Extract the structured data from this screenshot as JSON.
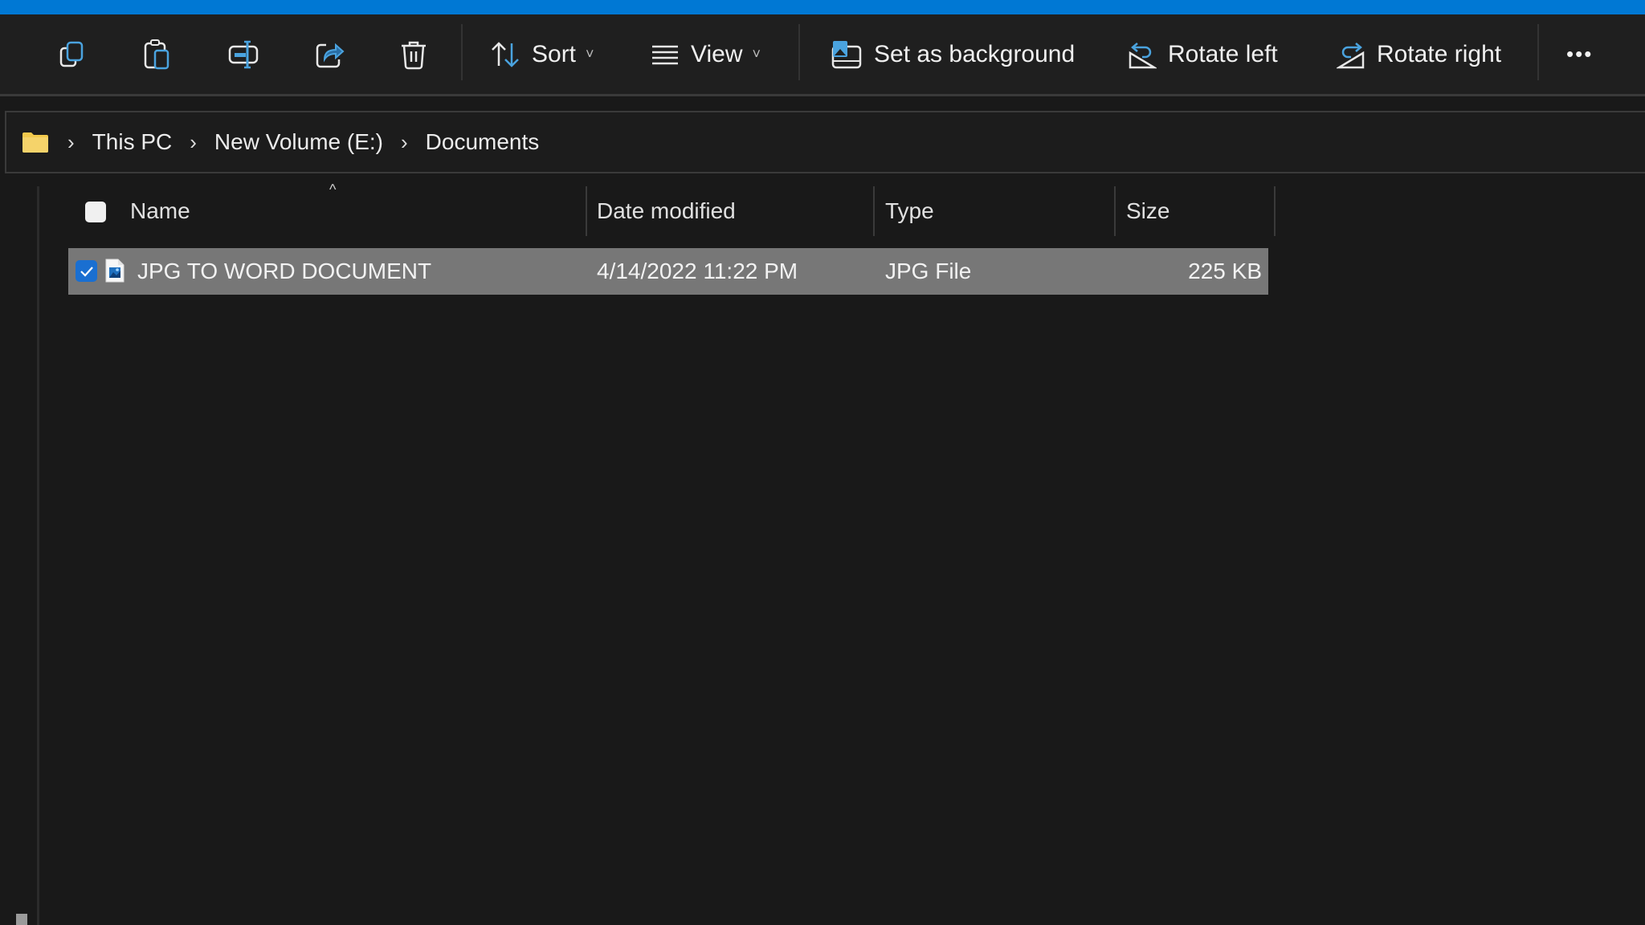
{
  "toolbar": {
    "copy_label": "Copy",
    "paste_label": "Paste",
    "rename_label": "Rename",
    "share_label": "Share",
    "delete_label": "Delete",
    "sort_label": "Sort",
    "view_label": "View",
    "set_background_label": "Set as background",
    "rotate_left_label": "Rotate left",
    "rotate_right_label": "Rotate right",
    "more_label": "•••"
  },
  "address_bar": {
    "icon": "folder-icon",
    "separator": "›",
    "breadcrumbs": [
      "This PC",
      "New Volume (E:)",
      "Documents"
    ]
  },
  "file_list": {
    "sort_indicator": "^",
    "columns": [
      "Name",
      "Date modified",
      "Type",
      "Size"
    ],
    "rows": [
      {
        "name": "JPG TO WORD DOCUMENT",
        "date_modified": "4/14/2022 11:22 PM",
        "type": "JPG File",
        "size": "225 KB",
        "selected": true
      }
    ]
  },
  "colors": {
    "accent": "#0078d4",
    "selection_row": "#777777",
    "checkbox_checked": "#1a6fd1",
    "background": "#191919",
    "folder": "#f2c94c"
  }
}
